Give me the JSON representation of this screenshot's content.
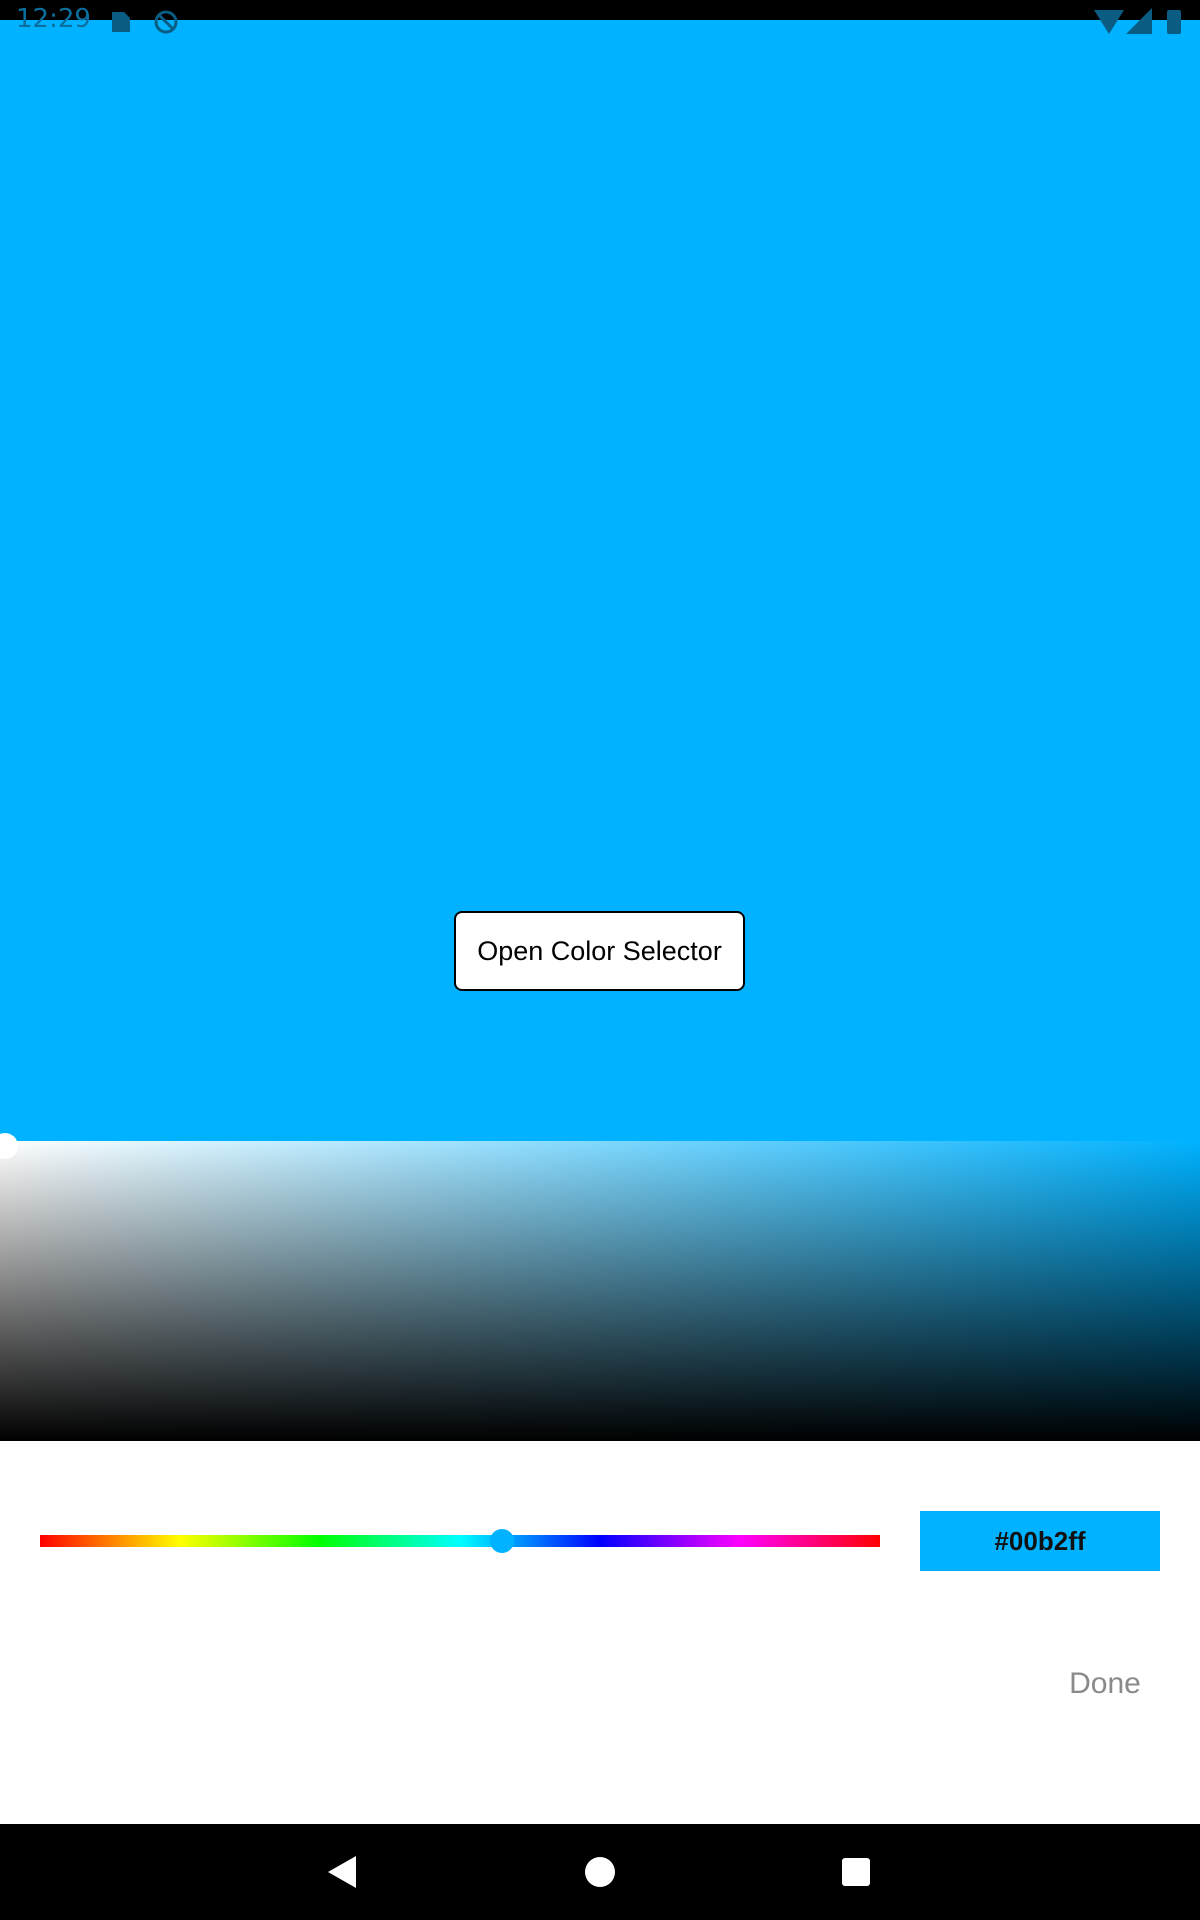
{
  "status_bar": {
    "time": "12:29",
    "icons": [
      "sd-card-icon",
      "sync-disabled-icon",
      "wifi-icon",
      "signal-icon",
      "battery-icon"
    ]
  },
  "preview": {
    "background_color": "#00b2ff",
    "open_button_label": "Open Color Selector"
  },
  "color_picker": {
    "selected_hex": "#00b2ff",
    "hue_gradient": [
      "#ff0000",
      "#ffff00",
      "#00ff00",
      "#00ffff",
      "#0000ff",
      "#ff00ff",
      "#ff0000"
    ],
    "hue_position": 0.55,
    "saturation": 0.0,
    "brightness": 1.0,
    "done_label": "Done"
  },
  "nav_bar": {
    "buttons": [
      "back-icon",
      "home-icon",
      "recents-icon"
    ]
  }
}
